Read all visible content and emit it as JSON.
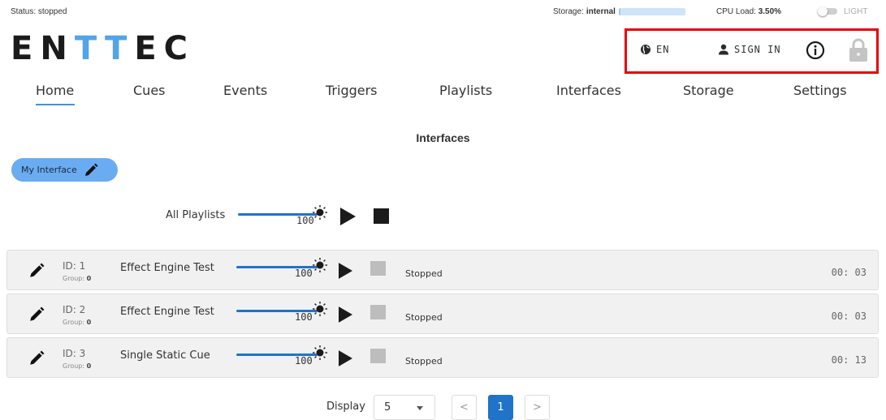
{
  "status_bar": {
    "status": "Status: stopped",
    "storage_label": "Storage:",
    "storage_value": "internal",
    "cpu_label": "CPU Load:",
    "cpu_value": "3.50%",
    "theme_label": "LIGHT"
  },
  "logo": {
    "part1": "EN",
    "part2": "TT",
    "part3": "EC",
    "accent_color": "#52a5e8"
  },
  "header": {
    "language": "EN",
    "sign_in": "SIGN IN",
    "icons": [
      "globe-icon",
      "user-icon",
      "info-icon",
      "lock-icon"
    ],
    "highlight_color": "#e8000b"
  },
  "nav": {
    "items": [
      "Home",
      "Cues",
      "Events",
      "Triggers",
      "Playlists",
      "Interfaces",
      "Storage",
      "Settings"
    ],
    "active": "Home"
  },
  "page_title": "Interfaces",
  "interface_chip": {
    "label": "My Interface",
    "color": "#6aacf2"
  },
  "all_playlists": {
    "label": "All Playlists",
    "level": "100"
  },
  "rows": [
    {
      "id": "ID: 1",
      "group_label": "Group:",
      "group": "0",
      "name": "Effect Engine Test",
      "level": "100",
      "status": "Stopped",
      "time": "00: 03"
    },
    {
      "id": "ID: 2",
      "group_label": "Group:",
      "group": "0",
      "name": "Effect Engine Test",
      "level": "100",
      "status": "Stopped",
      "time": "00: 03"
    },
    {
      "id": "ID: 3",
      "group_label": "Group:",
      "group": "0",
      "name": "Single Static Cue",
      "level": "100",
      "status": "Stopped",
      "time": "00: 13"
    }
  ],
  "pagination": {
    "display_label": "Display",
    "page_size": "5",
    "prev": "<",
    "current": "1",
    "next": ">"
  },
  "colors": {
    "accent": "#1f73c9",
    "row_bg": "#f1f1f1"
  }
}
